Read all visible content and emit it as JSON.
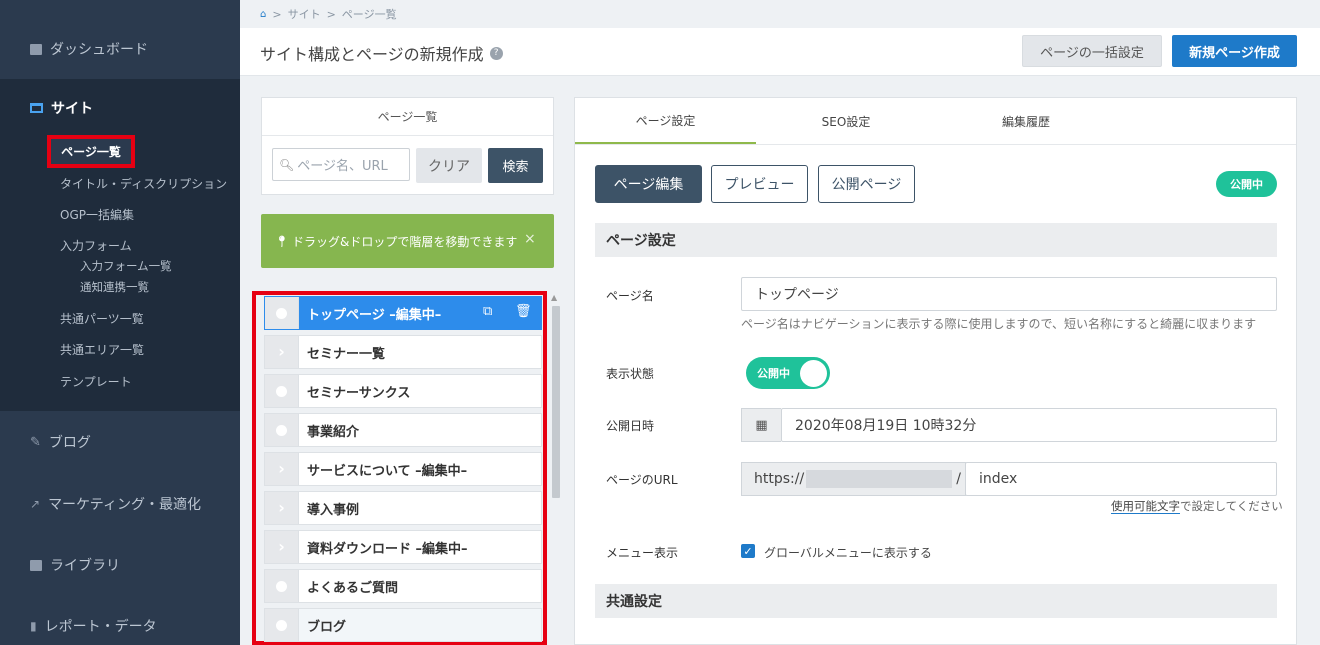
{
  "sidebar": {
    "dashboard": "ダッシュボード",
    "site": "サイト",
    "page_list": "ページ一覧",
    "sub_items": [
      "タイトル・ディスクリプション",
      "OGP一括編集",
      "入力フォーム"
    ],
    "form_sub": [
      "入力フォーム一覧",
      "通知連携一覧"
    ],
    "sub_items2": [
      "共通パーツ一覧",
      "共通エリア一覧",
      "テンプレート"
    ],
    "blog": "ブログ",
    "marketing": "マーケティング・最適化",
    "library": "ライブラリ",
    "report": "レポート・データ"
  },
  "breadcrumb": {
    "home_icon": "home-icon",
    "items": [
      "サイト",
      "ページ一覧"
    ],
    "sep": ">"
  },
  "header": {
    "title": "サイト構成とページの新規作成",
    "bulk_button": "ページの一括設定",
    "new_button": "新規ページ作成"
  },
  "left_panel": {
    "title": "ページ一覧",
    "search_placeholder": "ページ名、URL",
    "clear_button": "クリア",
    "search_button": "検索",
    "alert": "ドラッグ&ドロップで階層を移動できます",
    "alert_close": "×",
    "pages": [
      {
        "label": "トップページ –編集中–",
        "type": "dot"
      },
      {
        "label": "セミナー一覧",
        "type": "chevron"
      },
      {
        "label": "セミナーサンクス",
        "type": "dot"
      },
      {
        "label": "事業紹介",
        "type": "dot"
      },
      {
        "label": "サービスについて –編集中–",
        "type": "chevron"
      },
      {
        "label": "導入事例",
        "type": "chevron"
      },
      {
        "label": "資料ダウンロード –編集中–",
        "type": "chevron"
      },
      {
        "label": "よくあるご質問",
        "type": "dot"
      },
      {
        "label": "ブログ",
        "type": "dot"
      }
    ]
  },
  "right_panel": {
    "tabs": [
      "ページ設定",
      "SEO設定",
      "編集履歴"
    ],
    "edit_button": "ページ編集",
    "preview_button": "プレビュー",
    "public_button": "公開ページ",
    "status_badge": "公開中",
    "section_page": "ページ設定",
    "page_name_label": "ページ名",
    "page_name_value": "トップページ",
    "page_name_help": "ページ名はナビゲーションに表示する際に使用しますので、短い名称にすると綺麗に収まります",
    "visibility_label": "表示状態",
    "visibility_value": "公開中",
    "publish_date_label": "公開日時",
    "publish_date_value": "2020年08月19日 10時32分",
    "url_label": "ページのURL",
    "url_prefix": "https://",
    "url_slash": "/",
    "url_value": "index",
    "url_help_link": "使用可能文字",
    "url_help_rest": "で設定してください",
    "menu_label": "メニュー表示",
    "menu_checkbox": "グローバルメニューに表示する",
    "section_common": "共通設定"
  },
  "colors": {
    "sidebar": "#2b3a4e",
    "accent_blue": "#1e7ac9",
    "green": "#86b64f",
    "status_green": "#1fc29a",
    "highlight_red": "#e60012"
  }
}
